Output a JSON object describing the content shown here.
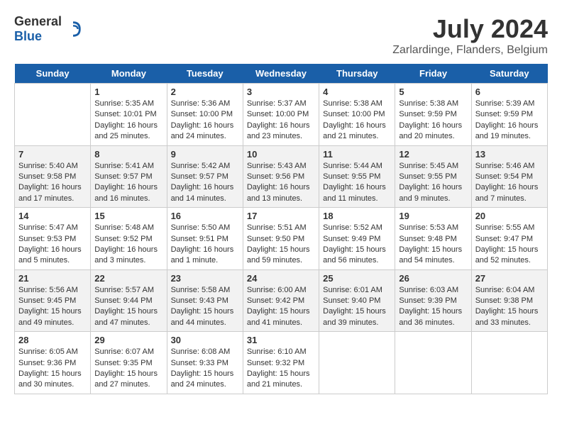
{
  "header": {
    "logo_general": "General",
    "logo_blue": "Blue",
    "title": "July 2024",
    "subtitle": "Zarlardinge, Flanders, Belgium"
  },
  "weekdays": [
    "Sunday",
    "Monday",
    "Tuesday",
    "Wednesday",
    "Thursday",
    "Friday",
    "Saturday"
  ],
  "weeks": [
    [
      {
        "date": "",
        "content": ""
      },
      {
        "date": "1",
        "content": "Sunrise: 5:35 AM\nSunset: 10:01 PM\nDaylight: 16 hours\nand 25 minutes."
      },
      {
        "date": "2",
        "content": "Sunrise: 5:36 AM\nSunset: 10:00 PM\nDaylight: 16 hours\nand 24 minutes."
      },
      {
        "date": "3",
        "content": "Sunrise: 5:37 AM\nSunset: 10:00 PM\nDaylight: 16 hours\nand 23 minutes."
      },
      {
        "date": "4",
        "content": "Sunrise: 5:38 AM\nSunset: 10:00 PM\nDaylight: 16 hours\nand 21 minutes."
      },
      {
        "date": "5",
        "content": "Sunrise: 5:38 AM\nSunset: 9:59 PM\nDaylight: 16 hours\nand 20 minutes."
      },
      {
        "date": "6",
        "content": "Sunrise: 5:39 AM\nSunset: 9:59 PM\nDaylight: 16 hours\nand 19 minutes."
      }
    ],
    [
      {
        "date": "7",
        "content": "Sunrise: 5:40 AM\nSunset: 9:58 PM\nDaylight: 16 hours\nand 17 minutes."
      },
      {
        "date": "8",
        "content": "Sunrise: 5:41 AM\nSunset: 9:57 PM\nDaylight: 16 hours\nand 16 minutes."
      },
      {
        "date": "9",
        "content": "Sunrise: 5:42 AM\nSunset: 9:57 PM\nDaylight: 16 hours\nand 14 minutes."
      },
      {
        "date": "10",
        "content": "Sunrise: 5:43 AM\nSunset: 9:56 PM\nDaylight: 16 hours\nand 13 minutes."
      },
      {
        "date": "11",
        "content": "Sunrise: 5:44 AM\nSunset: 9:55 PM\nDaylight: 16 hours\nand 11 minutes."
      },
      {
        "date": "12",
        "content": "Sunrise: 5:45 AM\nSunset: 9:55 PM\nDaylight: 16 hours\nand 9 minutes."
      },
      {
        "date": "13",
        "content": "Sunrise: 5:46 AM\nSunset: 9:54 PM\nDaylight: 16 hours\nand 7 minutes."
      }
    ],
    [
      {
        "date": "14",
        "content": "Sunrise: 5:47 AM\nSunset: 9:53 PM\nDaylight: 16 hours\nand 5 minutes."
      },
      {
        "date": "15",
        "content": "Sunrise: 5:48 AM\nSunset: 9:52 PM\nDaylight: 16 hours\nand 3 minutes."
      },
      {
        "date": "16",
        "content": "Sunrise: 5:50 AM\nSunset: 9:51 PM\nDaylight: 16 hours\nand 1 minute."
      },
      {
        "date": "17",
        "content": "Sunrise: 5:51 AM\nSunset: 9:50 PM\nDaylight: 15 hours\nand 59 minutes."
      },
      {
        "date": "18",
        "content": "Sunrise: 5:52 AM\nSunset: 9:49 PM\nDaylight: 15 hours\nand 56 minutes."
      },
      {
        "date": "19",
        "content": "Sunrise: 5:53 AM\nSunset: 9:48 PM\nDaylight: 15 hours\nand 54 minutes."
      },
      {
        "date": "20",
        "content": "Sunrise: 5:55 AM\nSunset: 9:47 PM\nDaylight: 15 hours\nand 52 minutes."
      }
    ],
    [
      {
        "date": "21",
        "content": "Sunrise: 5:56 AM\nSunset: 9:45 PM\nDaylight: 15 hours\nand 49 minutes."
      },
      {
        "date": "22",
        "content": "Sunrise: 5:57 AM\nSunset: 9:44 PM\nDaylight: 15 hours\nand 47 minutes."
      },
      {
        "date": "23",
        "content": "Sunrise: 5:58 AM\nSunset: 9:43 PM\nDaylight: 15 hours\nand 44 minutes."
      },
      {
        "date": "24",
        "content": "Sunrise: 6:00 AM\nSunset: 9:42 PM\nDaylight: 15 hours\nand 41 minutes."
      },
      {
        "date": "25",
        "content": "Sunrise: 6:01 AM\nSunset: 9:40 PM\nDaylight: 15 hours\nand 39 minutes."
      },
      {
        "date": "26",
        "content": "Sunrise: 6:03 AM\nSunset: 9:39 PM\nDaylight: 15 hours\nand 36 minutes."
      },
      {
        "date": "27",
        "content": "Sunrise: 6:04 AM\nSunset: 9:38 PM\nDaylight: 15 hours\nand 33 minutes."
      }
    ],
    [
      {
        "date": "28",
        "content": "Sunrise: 6:05 AM\nSunset: 9:36 PM\nDaylight: 15 hours\nand 30 minutes."
      },
      {
        "date": "29",
        "content": "Sunrise: 6:07 AM\nSunset: 9:35 PM\nDaylight: 15 hours\nand 27 minutes."
      },
      {
        "date": "30",
        "content": "Sunrise: 6:08 AM\nSunset: 9:33 PM\nDaylight: 15 hours\nand 24 minutes."
      },
      {
        "date": "31",
        "content": "Sunrise: 6:10 AM\nSunset: 9:32 PM\nDaylight: 15 hours\nand 21 minutes."
      },
      {
        "date": "",
        "content": ""
      },
      {
        "date": "",
        "content": ""
      },
      {
        "date": "",
        "content": ""
      }
    ]
  ]
}
